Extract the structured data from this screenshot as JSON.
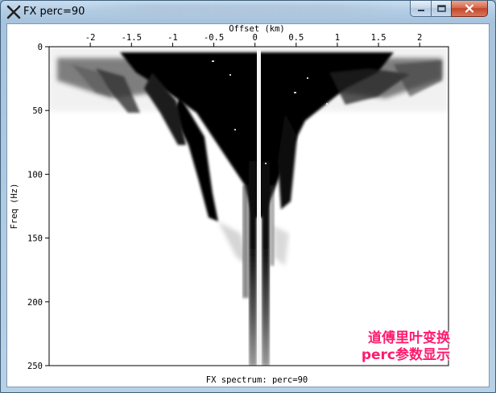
{
  "window": {
    "title": "FX perc=90",
    "app_icon": "x-icon",
    "buttons": {
      "minimize": "minimize-icon",
      "maximize": "maximize-icon",
      "close": "close-icon"
    }
  },
  "plot": {
    "xlabel": "Offset (km)",
    "ylabel": "Freq (Hz)",
    "caption": "FX spectrum: perc=90",
    "x_ticks": [
      "-2",
      "-1.5",
      "-1",
      "-0.5",
      "0",
      "0.5",
      "1",
      "1.5",
      "2"
    ],
    "y_ticks": [
      "0",
      "50",
      "100",
      "150",
      "200",
      "250"
    ],
    "xlim": [
      -2.5,
      2.35
    ],
    "ylim": [
      0,
      250
    ],
    "colormap": "grayscale (black = high amplitude)"
  },
  "annotation": {
    "line1": "道傅里叶变换",
    "line2": "perc参数显示",
    "color": "#ff1a6e"
  }
}
